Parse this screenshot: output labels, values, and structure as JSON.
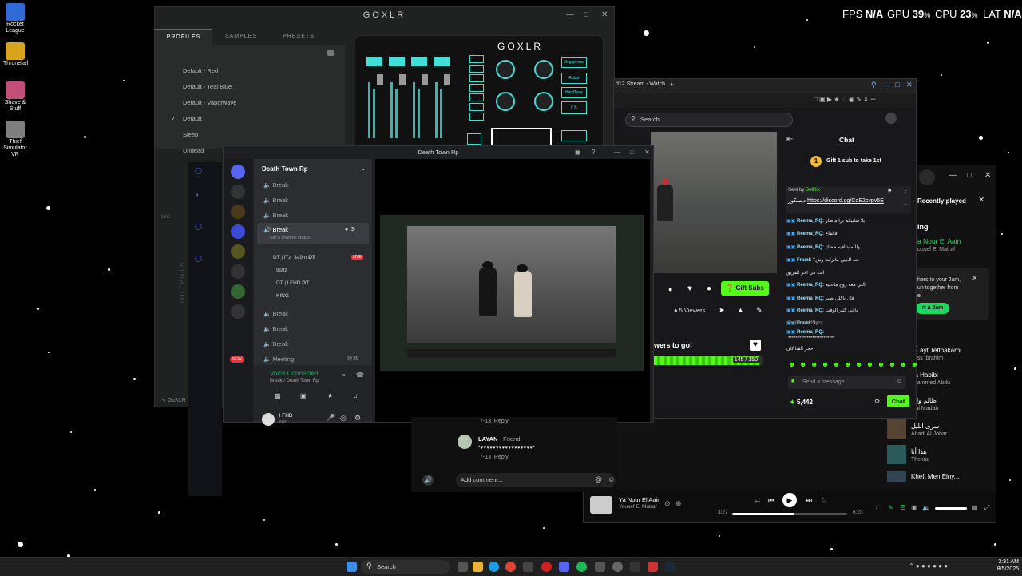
{
  "desktop_icons": [
    {
      "label": "Rocket League",
      "color": "#2f6bd6"
    },
    {
      "label": "Thronefall",
      "color": "#d8a21c"
    },
    {
      "label": "Shave & Stuff",
      "color": "#c44e7a"
    },
    {
      "label": "Thief Simulator VR",
      "color": "#7f7f7f"
    }
  ],
  "overlay": {
    "fps_label": "FPS",
    "fps_value": "N/A",
    "gpu_label": "GPU",
    "gpu_value": "39",
    "cpu_label": "CPU",
    "cpu_value": "23",
    "lat_label": "LAT",
    "lat_value": "N/A",
    "percent": "%"
  },
  "goxlr": {
    "title": "GOXLR",
    "tabs": [
      "PROFILES",
      "SAMPLES",
      "PRESETS"
    ],
    "profiles": [
      "Default - Red",
      "Default - Teal Blue",
      "Default - Vaporwave",
      "Default",
      "Sleep",
      "Undead"
    ],
    "active_profile_index": 3,
    "device_logo": "GOXLR",
    "side_buttons": [
      "Megaphone",
      "Robot",
      "HardTune",
      "FX"
    ],
    "bottom_left": "GoXLR",
    "outputs_label": "OUTPUTS",
    "mic_label": "MIC"
  },
  "discord": {
    "title": "Death Town Rp",
    "server_name": "Death Town Rp",
    "channels_top": [
      "Break",
      "Break",
      "Break"
    ],
    "active_channel": "Break",
    "channel_status_placeholder": "Set a channel status",
    "members": [
      {
        "name": "DT | lTz_3a9m",
        "tag": "DT",
        "live": "LIVE"
      },
      {
        "name": "9s9z",
        "tag": "",
        "live": ""
      },
      {
        "name": "DT | l FHD",
        "tag": "DT",
        "live": ""
      },
      {
        "name": "KING",
        "tag": "",
        "live": ""
      }
    ],
    "channels_bottom": [
      "Break",
      "Break",
      "Break",
      "Meeting"
    ],
    "meeting_count": "00",
    "meeting_limit": "99",
    "new_badge": "NEW",
    "voice_connected": "Voice Connected",
    "voice_location": "Break / Death Town Rp",
    "user_name": "l FHD",
    "user_status": "6rt2"
  },
  "browser": {
    "tab_title": "d12 Stream - Watch Li",
    "search_placeholder": "Search",
    "chat_title": "Chat",
    "gift_banner": "Gift 1 sub to take 1st",
    "gift_count": "1",
    "pinned_sender": "Sent by",
    "pinned_bot": "BotRix",
    "pinned_link": "https://discord.gg/CdE2cvpv6E",
    "pinned_prefix": "ديسكور",
    "messages": [
      {
        "user": "Reema_RQ:",
        "text": "يلا شابيكم ترا ماصار"
      },
      {
        "user": "Reema_RQ:",
        "text": "فالقاع"
      },
      {
        "user": "Reema_RQ:",
        "text": "والله شافيه حظك"
      },
      {
        "user": "Framl:",
        "text": "عند الجين مانزلت وش؟"
      },
      {
        "user": "",
        "text": "انت في اخر الفريق"
      },
      {
        "user": "Reema_RQ:",
        "text": "اللي معه روح ماعليه"
      },
      {
        "user": "Reema_RQ:",
        "text": "قال ياكلي صبر"
      },
      {
        "user": "Reema_RQ:",
        "text": "ياخي كثير الوقت"
      },
      {
        "user": "Framl:",
        "text": "يلا"
      },
      {
        "user": "Reema_RQ:",
        "text": ""
      },
      {
        "user": "",
        "text": "احجر القنا كان"
      }
    ],
    "replying": "Replying to Framl:",
    "stars": "*************************",
    "send_placeholder": "Send a message",
    "points": "5,442",
    "chat_button": "Chat",
    "gift_subs": "Gift Subs",
    "viewers": "5 Viewers",
    "goal_text": "wers to go!",
    "goal_progress": "145 / 150",
    "goal_fraction": 0.967
  },
  "spotify": {
    "recently_played": "Recently played",
    "heading_partial": "ing",
    "jam_text_1": "hers to your Jam,",
    "jam_text_2": "un together from",
    "jam_text_3": "e.",
    "jam_button": "rt a Jam",
    "featured_song": "a Nour El Aain",
    "featured_artist": "ousef El Matraf",
    "list": [
      {
        "title": "a Layt Tetthakarni",
        "artist": "bass Ibrahim"
      },
      {
        "title": "na Habibi",
        "artist": "ohammed Abdu"
      },
      {
        "title": "ظالم ولك",
        "artist": "alal Madah"
      },
      {
        "title": "سرى الليل",
        "artist": "Abadi Al Johar"
      },
      {
        "title": "هذا أنا",
        "artist": "Thekra"
      },
      {
        "title": "Kheft Men Einy...",
        "artist": ""
      }
    ],
    "now_playing_title": "Ya Nour El Aain",
    "now_playing_artist": "Yousef El Matraf",
    "time_elapsed": "3:27",
    "time_total": "6:23",
    "progress": 0.54
  },
  "yt": {
    "time_top": "7-13",
    "reply_top": "Reply",
    "comment_author": "LAYAN",
    "comment_badge": "Friend",
    "comment_text": "*♥♥♥♥♥♥♥♥♥♥♥♥♥♥♥♥♥*",
    "comment_time": "7-13",
    "comment_reply": "Reply",
    "add_comment": "Add comment..."
  },
  "taskbar": {
    "search_label": "Search",
    "time": "3:31 AM",
    "date": "8/5/2025"
  }
}
